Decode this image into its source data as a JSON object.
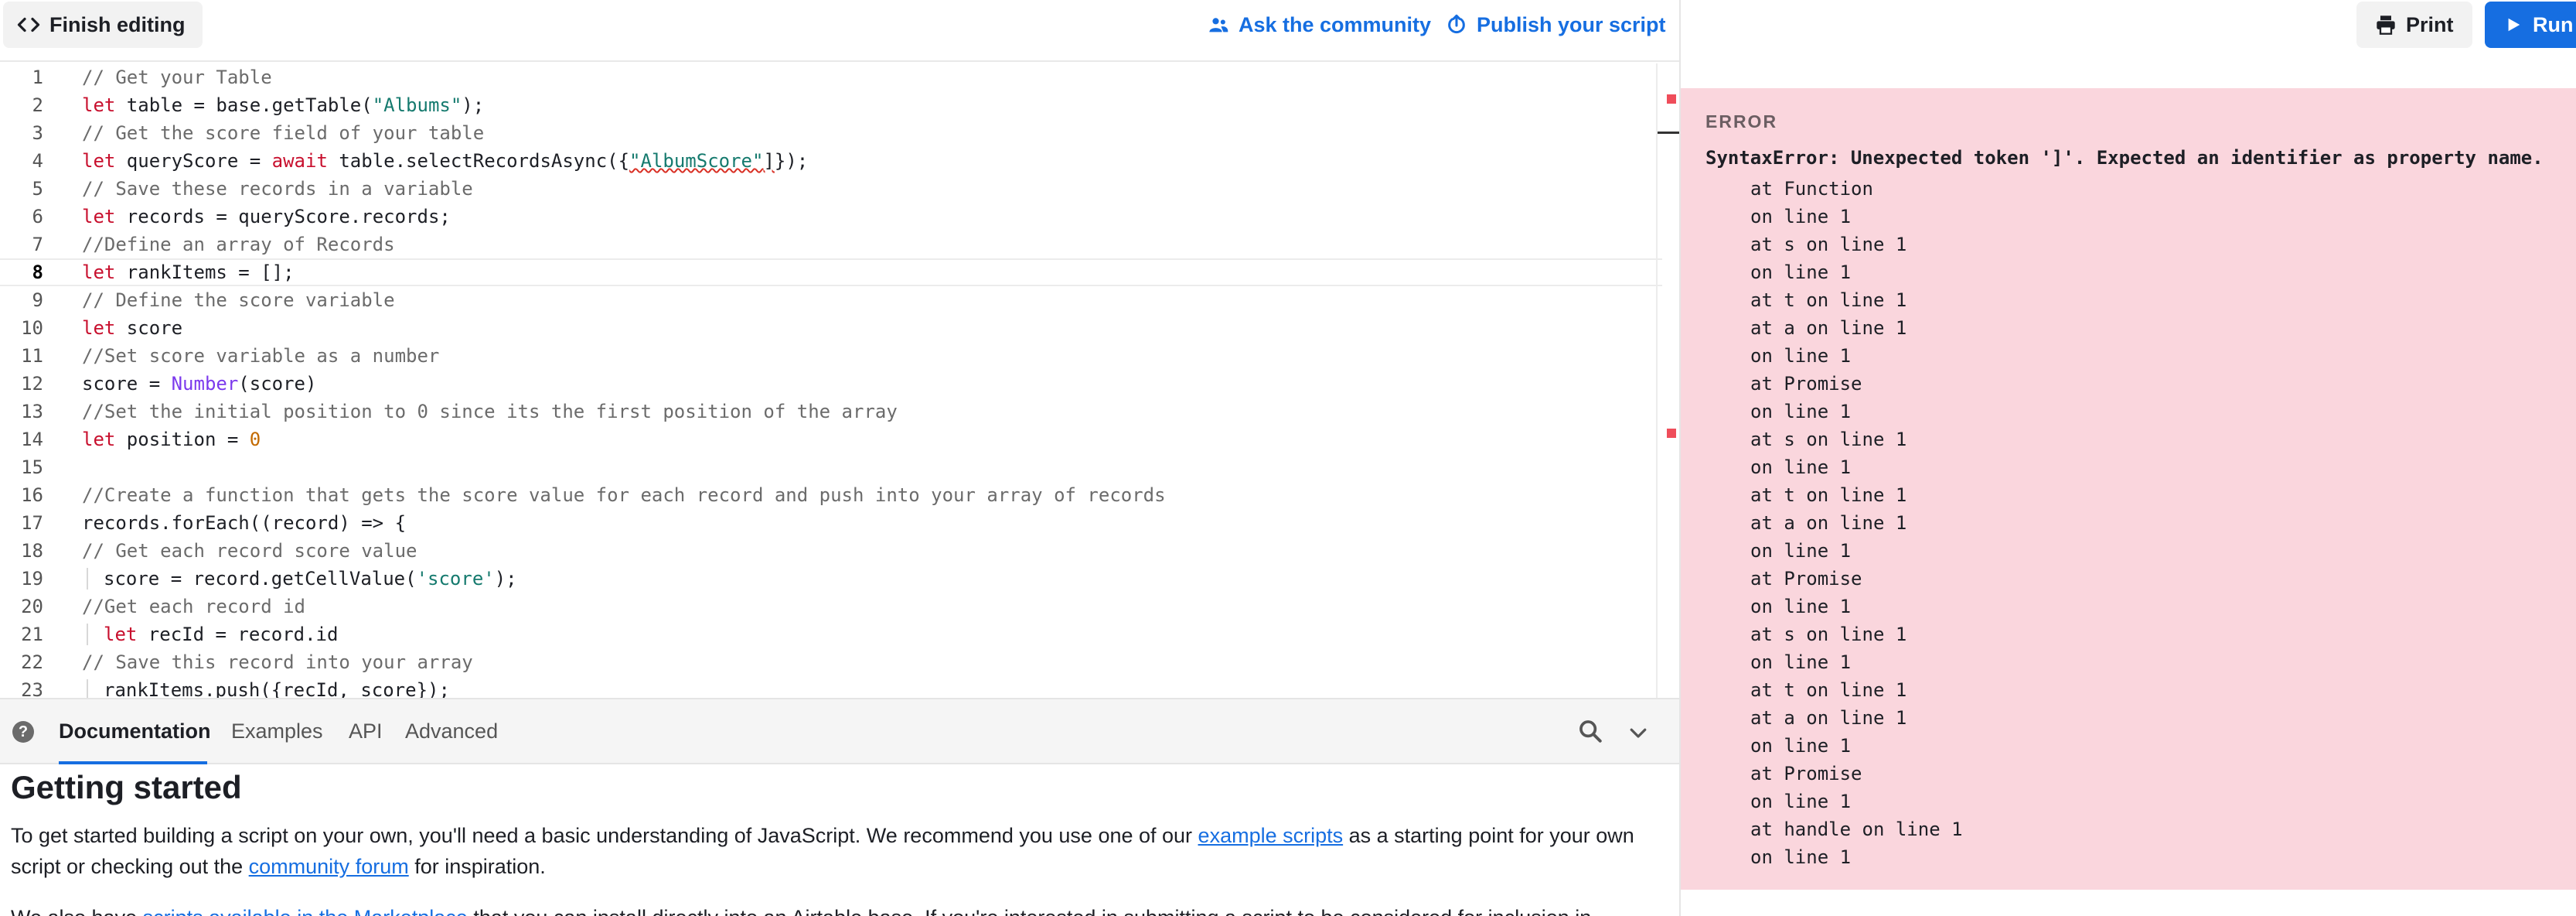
{
  "toolbar": {
    "finish_label": "Finish editing",
    "ask_label": "Ask the community",
    "publish_label": "Publish your script"
  },
  "output_toolbar": {
    "print_label": "Print",
    "run_label": "Run"
  },
  "editor": {
    "active_line": 8,
    "lines": [
      {
        "n": "1",
        "text": "// Get your Table"
      },
      {
        "n": "2",
        "text": "let table = base.getTable(\"Albums\");"
      },
      {
        "n": "3",
        "text": "// Get the score field of your table"
      },
      {
        "n": "4",
        "text": "let queryScore = await table.selectRecordsAsync({\"AlbumScore\"]});"
      },
      {
        "n": "5",
        "text": "// Save these records in a variable"
      },
      {
        "n": "6",
        "text": "let records = queryScore.records;"
      },
      {
        "n": "7",
        "text": "//Define an array of Records"
      },
      {
        "n": "8",
        "text": "let rankItems = [];"
      },
      {
        "n": "9",
        "text": "// Define the score variable"
      },
      {
        "n": "10",
        "text": "let score"
      },
      {
        "n": "11",
        "text": "//Set score variable as a number"
      },
      {
        "n": "12",
        "text": "score = Number(score)"
      },
      {
        "n": "13",
        "text": "//Set the initial position to 0 since its the first position of the array"
      },
      {
        "n": "14",
        "text": "let position = 0"
      },
      {
        "n": "15",
        "text": ""
      },
      {
        "n": "16",
        "text": "//Create a function that gets the score value for each record and push into your array of records"
      },
      {
        "n": "17",
        "text": "records.forEach((record) => {"
      },
      {
        "n": "18",
        "text": "// Get each record score value"
      },
      {
        "n": "19",
        "text": "score = record.getCellValue('score');"
      },
      {
        "n": "20",
        "text": "//Get each record id"
      },
      {
        "n": "21",
        "text": "let recId = record.id"
      },
      {
        "n": "22",
        "text": "// Save this record into your array"
      },
      {
        "n": "23",
        "text": "rankItems.push({recId, score});"
      }
    ]
  },
  "docs": {
    "tabs": [
      "Documentation",
      "Examples",
      "API",
      "Advanced"
    ],
    "active_tab": "Documentation",
    "title": "Getting started",
    "p1_a": "To get started building a script on your own, you'll need a basic understanding of JavaScript. We recommend you use one of our ",
    "p1_link1": "example scripts",
    "p1_b": " as a starting point for your own script or checking out the ",
    "p1_link2": "community forum",
    "p1_c": " for inspiration.",
    "p2_a": "We also have ",
    "p2_link": "scripts available in the Marketplace",
    "p2_b": " that you can install directly into an Airtable base. If you're interested in submitting a script to be considered for inclusion in"
  },
  "error": {
    "label": "ERROR",
    "title": "SyntaxError: Unexpected token ']'. Expected an identifier as property name.",
    "trace": [
      "at Function",
      "on line 1",
      "at s on line 1",
      "on line 1",
      "at t on line 1",
      "at a on line 1",
      "on line 1",
      "at Promise",
      "on line 1",
      "at s on line 1",
      "on line 1",
      "at t on line 1",
      "at a on line 1",
      "on line 1",
      "at Promise",
      "on line 1",
      "at s on line 1",
      "on line 1",
      "at t on line 1",
      "at a on line 1",
      "on line 1",
      "at Promise",
      "on line 1",
      "at handle on line 1",
      "on line 1"
    ]
  },
  "colors": {
    "accent": "#166ee1",
    "error_bg": "#fad6dd",
    "keyword": "#c8102e",
    "string": "#157a6e"
  }
}
